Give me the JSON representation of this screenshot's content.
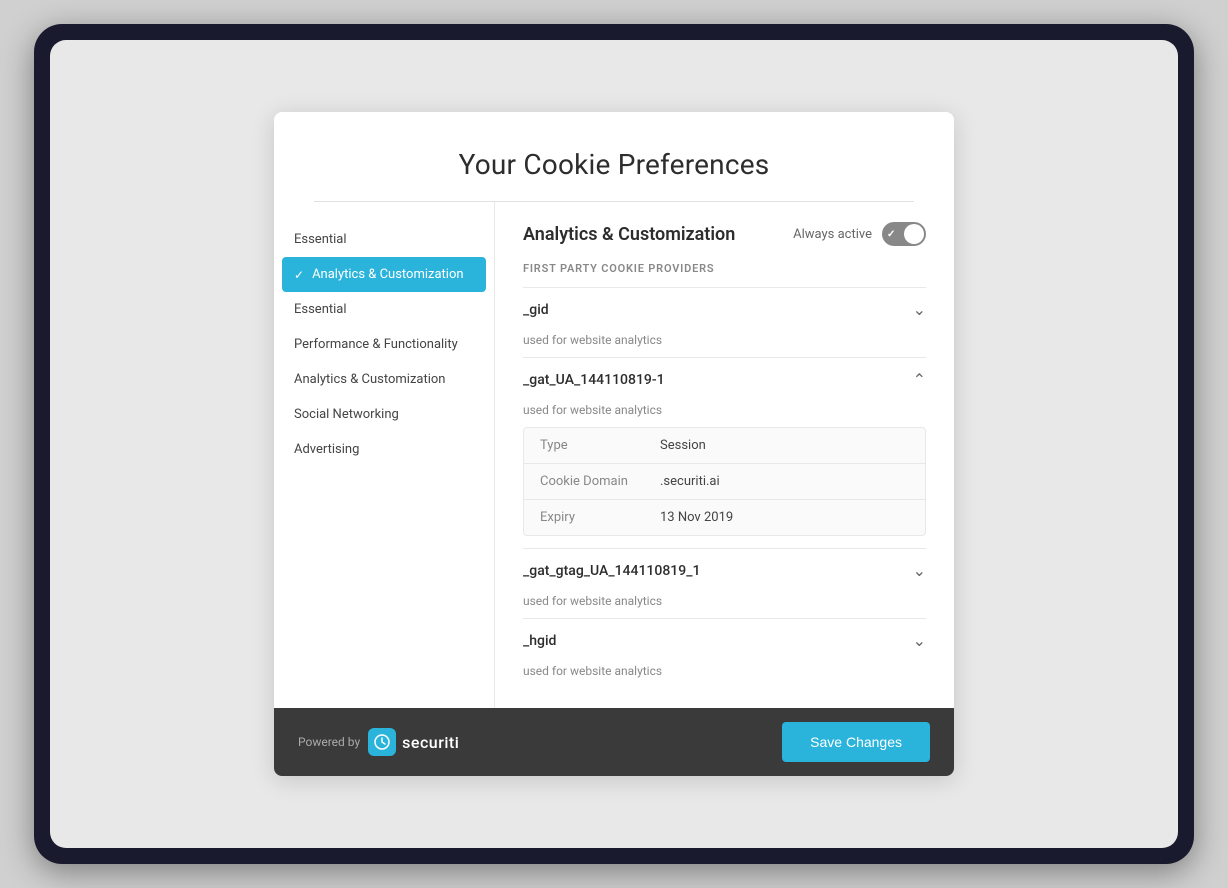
{
  "modal": {
    "title": "Your Cookie Preferences",
    "divider": true
  },
  "sidebar": {
    "items": [
      {
        "id": "essential-top",
        "label": "Essential",
        "active": false,
        "hasCheck": false
      },
      {
        "id": "analytics-customization",
        "label": "Analytics & Customization",
        "active": true,
        "hasCheck": true
      },
      {
        "id": "essential",
        "label": "Essential",
        "active": false,
        "hasCheck": false
      },
      {
        "id": "performance-functionality",
        "label": "Performance & Functionality",
        "active": false,
        "hasCheck": false
      },
      {
        "id": "analytics-customization-2",
        "label": "Analytics & Customization",
        "active": false,
        "hasCheck": false
      },
      {
        "id": "social-networking",
        "label": "Social Networking",
        "active": false,
        "hasCheck": false
      },
      {
        "id": "advertising",
        "label": "Advertising",
        "active": false,
        "hasCheck": false
      }
    ]
  },
  "content": {
    "title": "Analytics & Customization",
    "always_active_label": "Always active",
    "section_label": "FIRST PARTY COOKIE PROVIDERS",
    "cookies": [
      {
        "id": "gid",
        "name": "_gid",
        "description": "used for website analytics",
        "expanded": false,
        "details": []
      },
      {
        "id": "gat_ua",
        "name": "_gat_UA_144110819-1",
        "description": "used for website analytics",
        "expanded": true,
        "details": [
          {
            "label": "Type",
            "value": "Session"
          },
          {
            "label": "Cookie Domain",
            "value": ".securiti.ai"
          },
          {
            "label": "Expiry",
            "value": "13 Nov 2019"
          }
        ]
      },
      {
        "id": "gat_gtag",
        "name": "_gat_gtag_UA_144110819_1",
        "description": "used for website analytics",
        "expanded": false,
        "details": []
      },
      {
        "id": "hgid",
        "name": "_hgid",
        "description": "used for website analytics",
        "expanded": false,
        "details": []
      }
    ]
  },
  "footer": {
    "powered_by": "Powered by",
    "brand_name": "securiti",
    "save_button_label": "Save Changes"
  },
  "icons": {
    "chevron_down": "›",
    "chevron_up": "‹",
    "check": "✓"
  }
}
